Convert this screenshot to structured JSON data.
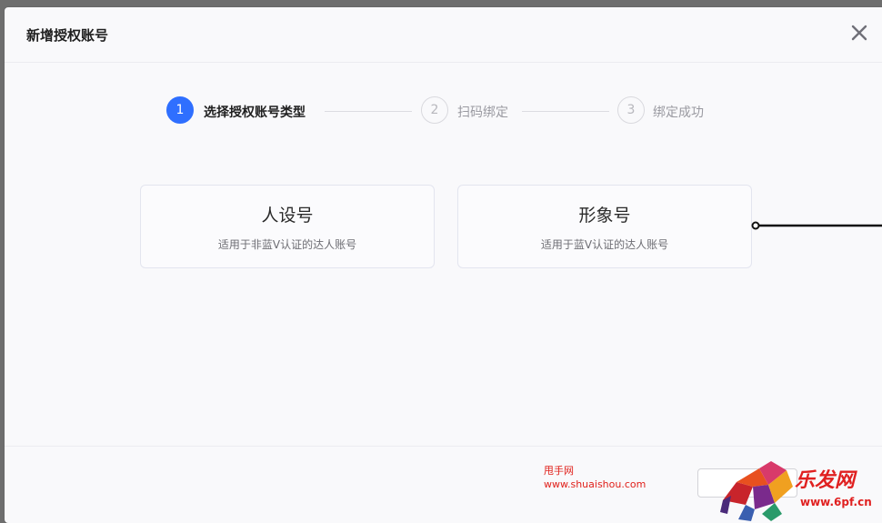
{
  "dialog": {
    "title": "新增授权账号"
  },
  "steps": [
    {
      "number": "1",
      "label": "选择授权账号类型"
    },
    {
      "number": "2",
      "label": "扫码绑定"
    },
    {
      "number": "3",
      "label": "绑定成功"
    }
  ],
  "cards": [
    {
      "title": "人设号",
      "description": "适用于非蓝V认证的达人账号"
    },
    {
      "title": "形象号",
      "description": "适用于蓝V认证的达人账号"
    }
  ],
  "watermark": {
    "brand": "甩手网",
    "url": "www.shuaishou.com",
    "site_name": "乐发网",
    "site_url": "www.6pf.cn"
  },
  "colors": {
    "accent": "#2f6fff",
    "overlay": "#6e6e6e"
  },
  "icons": {
    "close": "close-icon"
  }
}
